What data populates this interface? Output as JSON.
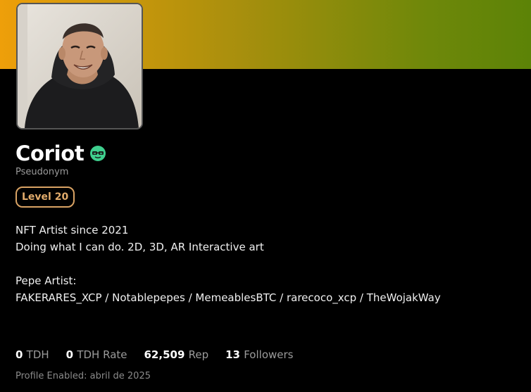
{
  "profile": {
    "name": "Coriot",
    "subtitle": "Pseudonym",
    "level": "Level 20",
    "badge_icon": "glasses-face-icon",
    "colors": {
      "banner_start": "#ee9f0a",
      "banner_end": "#5c8307",
      "level_accent": "#d9a364",
      "badge": "#3fcf8e"
    }
  },
  "bio": {
    "line1": "NFT Artist since 2021",
    "line2": "Doing what I can do. 2D, 3D, AR Interactive art",
    "line3": "Pepe Artist:",
    "line4": "FAKERARES_XCP / Notablepepes / MemeablesBTC / rarecoco_xcp / TheWojakWay"
  },
  "stats": {
    "tdh_value": "0",
    "tdh_label": "TDH",
    "tdh_rate_value": "0",
    "tdh_rate_label": "TDH Rate",
    "rep_value": "62,509",
    "rep_label": "Rep",
    "followers_value": "13",
    "followers_label": "Followers"
  },
  "profile_enabled": "Profile Enabled: abril de 2025"
}
